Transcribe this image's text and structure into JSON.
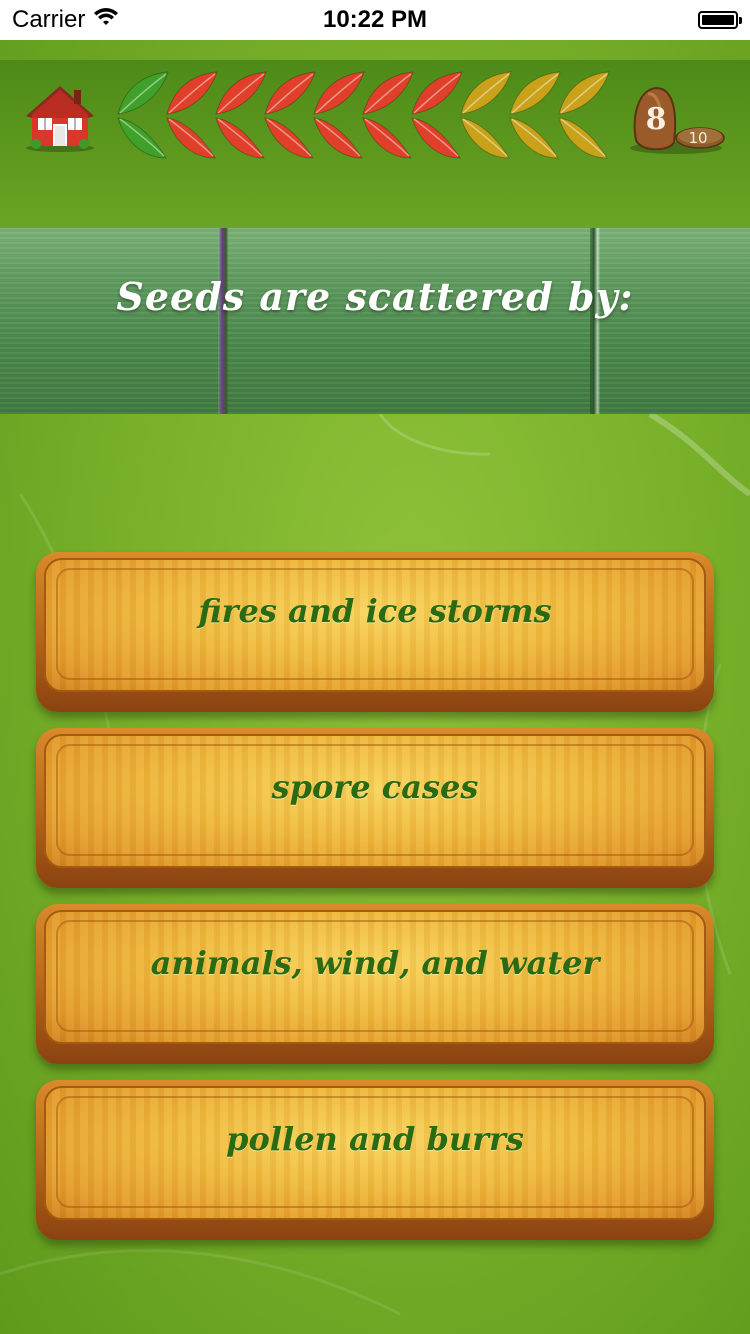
{
  "status_bar": {
    "carrier": "Carrier",
    "time": "10:22 PM"
  },
  "game_bar": {
    "home_icon": "house-icon",
    "progress_leaves": [
      {
        "state": "correct",
        "color": "#3fa02a"
      },
      {
        "state": "wrong",
        "color": "#e0402a"
      },
      {
        "state": "wrong",
        "color": "#e0402a"
      },
      {
        "state": "wrong",
        "color": "#e0402a"
      },
      {
        "state": "wrong",
        "color": "#e0402a"
      },
      {
        "state": "wrong",
        "color": "#e0402a"
      },
      {
        "state": "wrong",
        "color": "#e0402a"
      },
      {
        "state": "pending",
        "color": "#c9a21a"
      },
      {
        "state": "pending",
        "color": "#c9a21a"
      },
      {
        "state": "pending",
        "color": "#c9a21a"
      }
    ],
    "timer_icon": "seed-timer-icon",
    "timer_value": "8",
    "timer_total": "10"
  },
  "question": {
    "text": "Seeds are scattered by:"
  },
  "answers": [
    {
      "label": "fires and ice storms"
    },
    {
      "label": "spore cases"
    },
    {
      "label": "animals, wind, and water"
    },
    {
      "label": "pollen and burrs"
    }
  ],
  "colors": {
    "background": "#7ab22b",
    "answer_text": "#2a6a12",
    "question_text": "#ffffff"
  }
}
